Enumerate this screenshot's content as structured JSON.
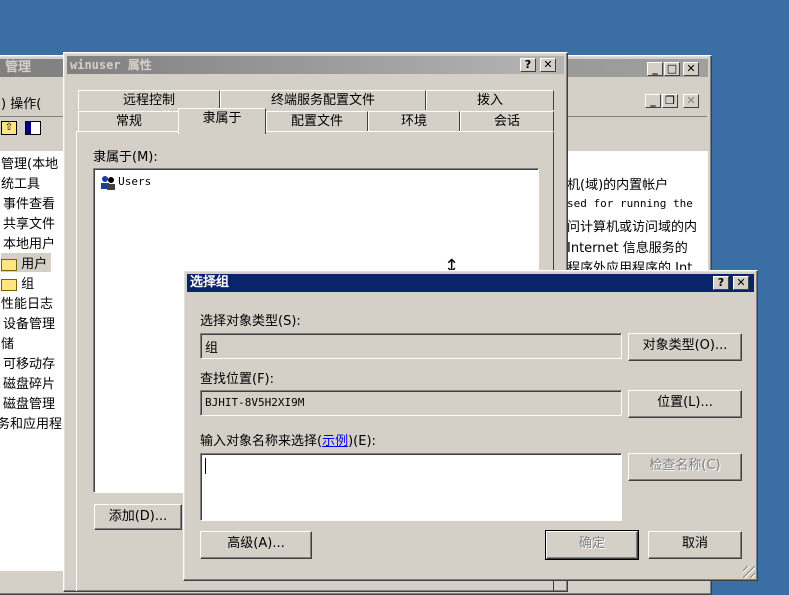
{
  "mmc": {
    "title": "管理",
    "menu": [
      "操作("
    ],
    "tree": [
      "管理(本地",
      "统工具",
      "事件查看",
      "共享文件",
      "本地用户",
      "用户",
      "组",
      "性能日志",
      "设备管理",
      "储",
      "可移动存",
      "磁盘碎片",
      "磁盘管理",
      "务和应用程"
    ],
    "desc": [
      "机(域)的内置帐户",
      "sed for running the",
      "问计算机或访问域的内",
      "Internet 信息服务的",
      "程序外应用程序的 Int"
    ]
  },
  "props": {
    "title": "winuser 属性",
    "tabs_row1": [
      "远程控制",
      "终端服务配置文件",
      "拨入"
    ],
    "tabs_row2": [
      "常规",
      "隶属于",
      "配置文件",
      "环境",
      "会话"
    ],
    "member_of_label": "隶属于(M):",
    "member_of_hotkey": "M",
    "groups": [
      "Users"
    ],
    "add_button": "添加(D)..."
  },
  "dialog": {
    "title": "选择组",
    "object_type_label": "选择对象类型(S):",
    "object_type_value": "组",
    "object_type_button": "对象类型(O)...",
    "location_label": "查找位置(F):",
    "location_value": "BJHIT-8V5H2XI9M",
    "location_button": "位置(L)...",
    "names_label_pre": "输入对象名称来选择(",
    "names_label_link": "示例",
    "names_label_post": ")(E):",
    "check_names_button": "检查名称(C)",
    "advanced_button": "高级(A)...",
    "ok_button": "确定",
    "cancel_button": "取消"
  },
  "colors": {
    "desktop": "#3a6ea5",
    "active_title": "#0a246a",
    "inactive_title": "#808080"
  }
}
